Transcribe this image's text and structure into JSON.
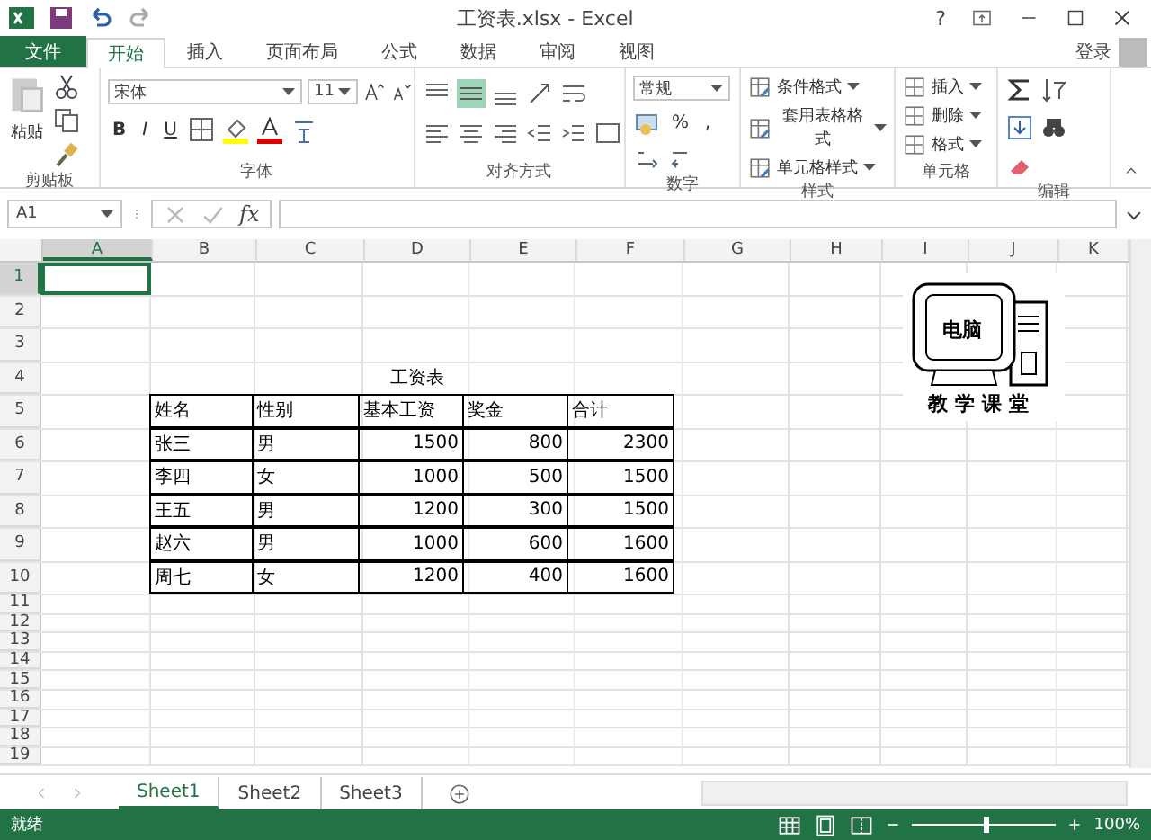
{
  "window": {
    "title": "工资表.xlsx - Excel",
    "help": "?",
    "sign_in": "登录"
  },
  "tabs": [
    {
      "label": "文件",
      "kind": "file",
      "selected": false
    },
    {
      "label": "开始",
      "kind": "tab",
      "selected": true
    },
    {
      "label": "插入",
      "kind": "tab",
      "selected": false
    },
    {
      "label": "页面布局",
      "kind": "tab",
      "selected": false
    },
    {
      "label": "公式",
      "kind": "tab",
      "selected": false
    },
    {
      "label": "数据",
      "kind": "tab",
      "selected": false
    },
    {
      "label": "审阅",
      "kind": "tab",
      "selected": false
    },
    {
      "label": "视图",
      "kind": "tab",
      "selected": false
    }
  ],
  "ribbon": {
    "clipboard": {
      "paste": "粘贴",
      "group": "剪贴板"
    },
    "font": {
      "font_name": "宋体",
      "font_size": "11",
      "bold": "B",
      "italic": "I",
      "underline": "U",
      "group": "字体"
    },
    "alignment": {
      "group": "对齐方式"
    },
    "number": {
      "format": "常规",
      "percent": "%",
      "comma": ",",
      "group": "数字"
    },
    "styles": {
      "items": [
        "条件格式",
        "套用表格格式",
        "单元格样式"
      ],
      "group": "样式"
    },
    "cells": {
      "items": [
        "插入",
        "删除",
        "格式"
      ],
      "group": "单元格"
    },
    "editing": {
      "group": "编辑"
    }
  },
  "formula_bar": {
    "name_box": "A1",
    "fx": "fx"
  },
  "sheet": {
    "columns": [
      {
        "label": "A",
        "selected": true
      },
      {
        "label": "B",
        "selected": false
      },
      {
        "label": "C",
        "selected": false
      },
      {
        "label": "D",
        "selected": false
      },
      {
        "label": "E",
        "selected": false
      },
      {
        "label": "F",
        "selected": false
      },
      {
        "label": "G",
        "selected": false
      },
      {
        "label": "H",
        "selected": false
      },
      {
        "label": "I",
        "selected": false
      },
      {
        "label": "J",
        "selected": false
      },
      {
        "label": "K",
        "selected": false
      }
    ],
    "rows": [
      {
        "label": "1",
        "selected": true,
        "kind": "blank",
        "cells": []
      },
      {
        "label": "2",
        "selected": false,
        "kind": "blank",
        "cells": []
      },
      {
        "label": "3",
        "selected": false,
        "kind": "blank",
        "cells": []
      },
      {
        "label": "4",
        "selected": false,
        "kind": "title",
        "cells": [
          "",
          "",
          "",
          "工资表"
        ]
      },
      {
        "label": "5",
        "selected": false,
        "kind": "header",
        "cells": [
          "",
          "姓名",
          "性别",
          "基本工资",
          "奖金",
          "合计"
        ]
      },
      {
        "label": "6",
        "selected": false,
        "kind": "data",
        "cells": [
          "",
          "张三",
          "男",
          "1500",
          "800",
          "2300"
        ]
      },
      {
        "label": "7",
        "selected": false,
        "kind": "data",
        "cells": [
          "",
          "李四",
          "女",
          "1000",
          "500",
          "1500"
        ]
      },
      {
        "label": "8",
        "selected": false,
        "kind": "data",
        "cells": [
          "",
          "王五",
          "男",
          "1200",
          "300",
          "1500"
        ]
      },
      {
        "label": "9",
        "selected": false,
        "kind": "data",
        "cells": [
          "",
          "赵六",
          "男",
          "1000",
          "600",
          "1600"
        ]
      },
      {
        "label": "10",
        "selected": false,
        "kind": "data",
        "cells": [
          "",
          "周七",
          "女",
          "1200",
          "400",
          "1600"
        ]
      },
      {
        "label": "11",
        "selected": false,
        "kind": "blank",
        "cells": []
      },
      {
        "label": "12",
        "selected": false,
        "kind": "blank",
        "cells": []
      },
      {
        "label": "13",
        "selected": false,
        "kind": "blank",
        "cells": []
      },
      {
        "label": "14",
        "selected": false,
        "kind": "blank",
        "cells": []
      },
      {
        "label": "15",
        "selected": false,
        "kind": "blank",
        "cells": []
      },
      {
        "label": "16",
        "selected": false,
        "kind": "blank",
        "cells": []
      },
      {
        "label": "17",
        "selected": false,
        "kind": "blank",
        "cells": []
      },
      {
        "label": "18",
        "selected": false,
        "kind": "blank",
        "cells": []
      },
      {
        "label": "19",
        "selected": false,
        "kind": "blank",
        "cells": []
      }
    ],
    "logo": {
      "screen_text": "电脑",
      "caption": "教学课堂"
    }
  },
  "sheet_tabs": [
    {
      "label": "Sheet1",
      "selected": true
    },
    {
      "label": "Sheet2",
      "selected": false
    },
    {
      "label": "Sheet3",
      "selected": false
    }
  ],
  "status_bar": {
    "status": "就绪",
    "zoom": "100%",
    "zoom_slider": {
      "level": 0.5
    }
  }
}
